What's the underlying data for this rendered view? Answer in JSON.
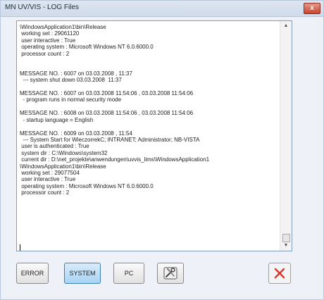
{
  "window": {
    "title": "MN UV/VIS - LOG Files",
    "close_glyph": "x"
  },
  "log": {
    "lines": [
      "\\WindowsApplication1\\bin\\Release",
      " working set : 29061120",
      " user interactive : True",
      " operating system : Microsoft Windows NT 6.0.6000.0",
      " processor count : 2",
      "",
      "",
      "MESSAGE NO. : 6007 on 03.03.2008 , 11:37",
      "  --- system shut down 03.03.2008  11:37",
      "",
      "MESSAGE NO. : 6007 on 03.03.2008 11:54:06 , 03.03.2008 11:54:06",
      "  - program runs in normal security mode",
      "",
      "MESSAGE NO. : 6008 on 03.03.2008 11:54:06 , 03.03.2008 11:54:06",
      "  - startup language = English",
      "",
      "MESSAGE NO. : 6009 on 03.03.2008 , 11:54",
      "  --- System Start for WieczorrekC; INTRANET; Administrator; NB-VISTA",
      " user is authenticated : True",
      " system dir : C:\\Windows\\system32",
      " current dir : D:\\net_projekte\\anwendungen\\uvvis_lims\\WindowsApplication1",
      "\\WindowsApplication1\\bin\\Release",
      " working set : 29077504",
      " user interactive : True",
      " operating system : Microsoft Windows NT 6.0.6000.0",
      " processor count : 2"
    ]
  },
  "buttons": {
    "error_label": "ERROR",
    "system_label": "SYSTEM",
    "pc_label": "PC",
    "tool_icon": "settings-tools-icon",
    "close_icon": "close-x-icon"
  },
  "colors": {
    "close_red": "#d9352a",
    "system_active": "#a8d4f3",
    "titlebar": "#cfdaea"
  }
}
